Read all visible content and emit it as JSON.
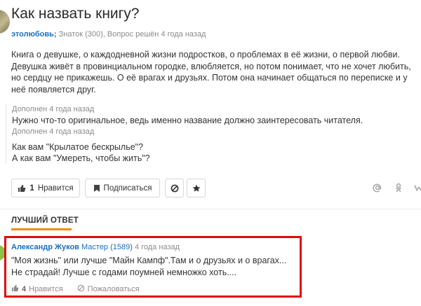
{
  "question": {
    "title": "Как назвать книгу?",
    "author": "этолюбовь;",
    "meta": " Знаток (300), Вопрос решён 4 года назад",
    "body": "Книга о девушке, о каждодневной жизни подростков, о проблемах в её жизни, о первой любви. Девушка живёт в провинциальном городке, влюбляется, но потом понимает, что не хочет любить, но сердцу не прикажешь. О её врагах и друзьях. Потом она начинает общаться по переписке и у неё появляется друг.",
    "additions": [
      {
        "meta": "Дополнен 4 года назад",
        "lines": [
          "Нужно что-то оригинальное, ведь именно название должно заинтересовать читателя."
        ]
      },
      {
        "meta": "Дополнен 4 года назад",
        "lines": [
          "Как вам \"Крылатое бескрылье\"?",
          "А как вам \"Умереть, чтобы жить\"?"
        ]
      }
    ]
  },
  "actions": {
    "like_count": "1",
    "like_label": "Нравится",
    "subscribe_label": "Подписаться"
  },
  "best_answer": {
    "section_label": "ЛУЧШИЙ ОТВЕТ",
    "author": "Александр Жуков",
    "rank": "Мастер (1589)",
    "time": "4 года назад",
    "lines": [
      "\"Моя жизнь\" или лучше \"Майн Кампф\".Там и о друзьях и о врагах...",
      "Не страдай! Лучше с годами поумней немножко хоть...."
    ],
    "like_count": "4",
    "like_label": "Нравится",
    "complain_label": "Пожаловаться"
  },
  "colors": {
    "link": "#1a6fc0",
    "accent": "#f28c00",
    "highlight": "#e10b0b"
  },
  "icons": [
    "thumbs-up-icon",
    "bookmark-icon",
    "block-icon",
    "star-icon",
    "at-icon",
    "odnoklassniki-icon",
    "vk-icon"
  ]
}
